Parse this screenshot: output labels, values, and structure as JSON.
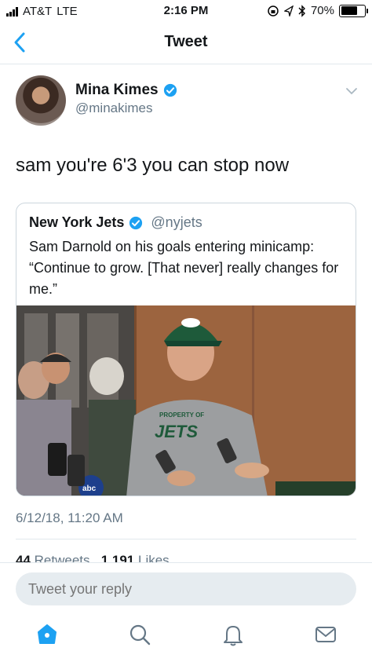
{
  "status_bar": {
    "carrier": "AT&T",
    "network": "LTE",
    "time": "2:16 PM",
    "battery_percent": "70%",
    "battery_level": 0.7
  },
  "nav": {
    "title": "Tweet",
    "back_icon": "chevron-left-icon"
  },
  "tweet": {
    "author_name": "Mina Kimes",
    "author_handle": "@minakimes",
    "text": "sam you're 6'3 you can stop now",
    "timestamp": "6/12/18, 11:20 AM",
    "retweets": "44",
    "retweets_label": "Retweets",
    "likes": "1,191",
    "likes_label": "Likes"
  },
  "quote": {
    "author_name": "New York Jets",
    "author_handle": "@nyjets",
    "text": "Sam Darnold on his goals entering minicamp: “Continue to grow. [That never] really changes for me.”"
  },
  "photo_text": {
    "shirt_line1": "PROPERTY OF",
    "shirt_line2": "JETS",
    "mic_label": "abc"
  },
  "reply": {
    "placeholder": "Tweet your reply"
  },
  "tabs": [
    {
      "name": "home",
      "icon": "home-icon"
    },
    {
      "name": "search",
      "icon": "search-icon"
    },
    {
      "name": "notifications",
      "icon": "bell-icon"
    },
    {
      "name": "messages",
      "icon": "envelope-icon"
    }
  ],
  "colors": {
    "accent": "#1da1f2",
    "secondary_text": "#657786",
    "border": "#e1e8ed"
  }
}
